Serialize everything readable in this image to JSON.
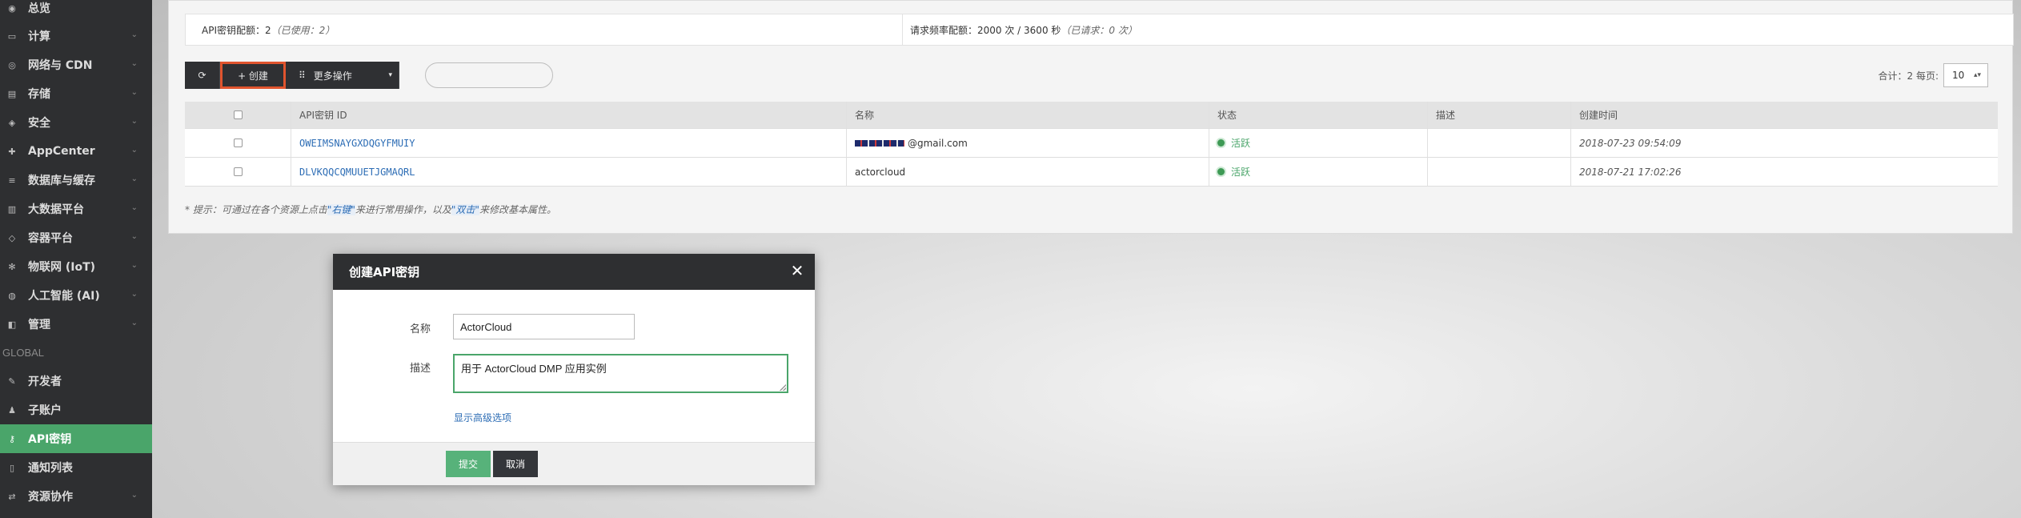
{
  "sidebar": {
    "items": [
      {
        "label": "总览",
        "icon": "dashboard-icon",
        "glyph": "◉"
      },
      {
        "label": "计算",
        "icon": "monitor-icon",
        "glyph": "▭"
      },
      {
        "label": "网络与 CDN",
        "icon": "network-icon",
        "glyph": "◎"
      },
      {
        "label": "存储",
        "icon": "storage-icon",
        "glyph": "▤"
      },
      {
        "label": "安全",
        "icon": "shield-icon",
        "glyph": "◈"
      },
      {
        "label": "AppCenter",
        "icon": "appcenter-icon",
        "glyph": "✚"
      },
      {
        "label": "数据库与缓存",
        "icon": "database-icon",
        "glyph": "≡"
      },
      {
        "label": "大数据平台",
        "icon": "bar-chart-icon",
        "glyph": "▥"
      },
      {
        "label": "容器平台",
        "icon": "container-icon",
        "glyph": "◇"
      },
      {
        "label": "物联网 (IoT)",
        "icon": "iot-icon",
        "glyph": "✻"
      },
      {
        "label": "人工智能 (AI)",
        "icon": "ai-icon",
        "glyph": "◍"
      },
      {
        "label": "管理",
        "icon": "manage-icon",
        "glyph": "◧"
      },
      {
        "label": "开发者",
        "icon": "wrench-icon",
        "glyph": "✎"
      },
      {
        "label": "子账户",
        "icon": "users-icon",
        "glyph": "♟"
      },
      {
        "label": "API密钥",
        "icon": "key-icon",
        "glyph": "⚷"
      },
      {
        "label": "通知列表",
        "icon": "notification-icon",
        "glyph": "▯"
      },
      {
        "label": "资源协作",
        "icon": "collaboration-icon",
        "glyph": "⇄"
      }
    ],
    "group_label": "GLOBAL",
    "chevron": "⌄",
    "active_label": "API密钥"
  },
  "quota": {
    "api_label": "API密钥配额：",
    "api_value": "2",
    "api_used": "（已使用：2）",
    "rate_label": "请求频率配额：",
    "rate_value": "2000 次 / 3600 秒",
    "rate_used": "（已请求：0 次）"
  },
  "toolbar": {
    "refresh_glyph": "⟳",
    "create_label": "+  创建",
    "more_label": "更多操作",
    "more_glyph": "⠿",
    "caret": "▾"
  },
  "pager": {
    "total_label": "合计：2  每页:",
    "page_size": "10",
    "caret": "▴▾"
  },
  "table": {
    "headers": [
      "API密钥 ID",
      "名称",
      "状态",
      "描述",
      "创建时间"
    ],
    "rows": [
      {
        "id": "OWEIMSNAYGXDQGYFMUIY",
        "name": "@gmail.com",
        "status": "活跃",
        "desc": "",
        "time": "2018-07-23 09:54:09"
      },
      {
        "id": "DLVKQQCQMUUETJGMAQRL",
        "name": "actorcloud",
        "status": "活跃",
        "desc": "",
        "time": "2018-07-21 17:02:26"
      }
    ]
  },
  "hint": {
    "prefix": "* 提示：可通过在各个资源上点击",
    "right_click": "\"右键\"",
    "middle": "来进行常用操作，以及",
    "double_click": "\"双击\"",
    "suffix": "来修改基本属性。"
  },
  "modal": {
    "title": "创建API密钥",
    "close_glyph": "✕",
    "name_label": "名称",
    "name_value": "ActorCloud",
    "desc_label": "描述",
    "desc_value": "用于 ActorCloud DMP 应用实例",
    "advanced_link": "显示高级选项",
    "submit_label": "提交",
    "cancel_label": "取消"
  },
  "colors": {
    "sidebar_bg": "#2e2f31",
    "accent_green": "#4aa56a",
    "highlight_red": "#e0542e",
    "link_blue": "#2d6db5"
  }
}
